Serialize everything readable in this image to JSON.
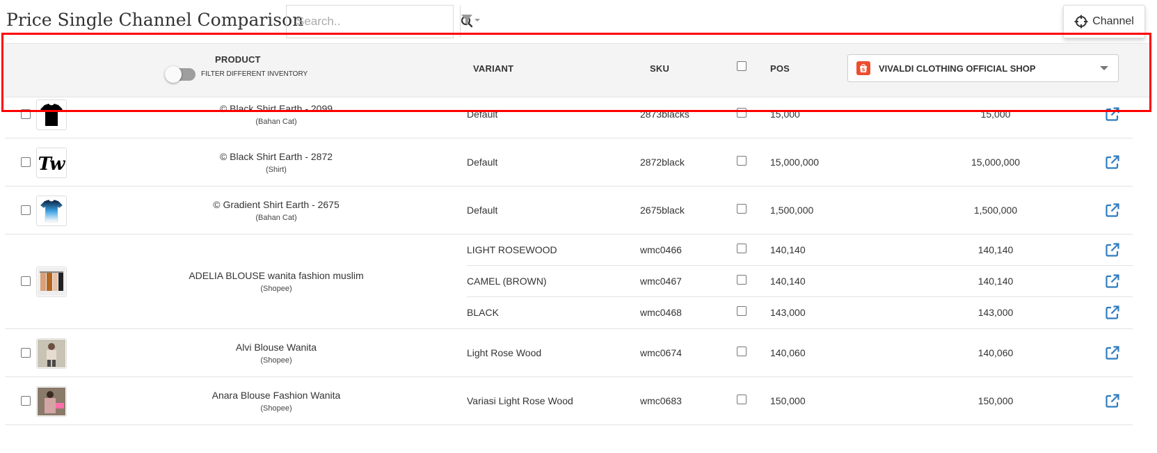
{
  "header": {
    "title": "Price Single Channel Comparison",
    "search_placeholder": "Search..",
    "channel_button": "Channel"
  },
  "table": {
    "columns": {
      "product": "PRODUCT",
      "filter_label": "FILTER DIFFERENT INVENTORY",
      "variant": "VARIANT",
      "sku": "SKU",
      "pos": "POS"
    },
    "selected_channel": "VIVALDI CLOTHING OFFICIAL SHOP",
    "products": [
      {
        "name": "© Black Shirt Earth - 2099",
        "category": "(Bahan Cat)",
        "thumb": "black-shirt",
        "variants": [
          {
            "variant": "Default",
            "sku": "2873blacks",
            "pos": "15,000",
            "channel": "15,000"
          }
        ]
      },
      {
        "name": "© Black Shirt Earth - 2872",
        "category": "(Shirt)",
        "thumb": "tw-logo",
        "variants": [
          {
            "variant": "Default",
            "sku": "2872black",
            "pos": "15,000,000",
            "channel": "15,000,000"
          }
        ]
      },
      {
        "name": "© Gradient Shirt Earth - 2675",
        "category": "(Bahan Cat)",
        "thumb": "gradient-shirt",
        "variants": [
          {
            "variant": "Default",
            "sku": "2675black",
            "pos": "1,500,000",
            "channel": "1,500,000"
          }
        ]
      },
      {
        "name": "ADELIA BLOUSE wanita fashion muslim",
        "category": "(Shopee)",
        "thumb": "blouse-rack",
        "variants": [
          {
            "variant": "LIGHT ROSEWOOD",
            "sku": "wmc0466",
            "pos": "140,140",
            "channel": "140,140"
          },
          {
            "variant": "CAMEL (BROWN)",
            "sku": "wmc0467",
            "pos": "140,140",
            "channel": "140,140"
          },
          {
            "variant": "BLACK",
            "sku": "wmc0468",
            "pos": "143,000",
            "channel": "143,000"
          }
        ]
      },
      {
        "name": "Alvi Blouse Wanita",
        "category": "(Shopee)",
        "thumb": "model-photo",
        "variants": [
          {
            "variant": "Light Rose Wood",
            "sku": "wmc0674",
            "pos": "140,060",
            "channel": "140,060"
          }
        ]
      },
      {
        "name": "Anara Blouse Fashion Wanita",
        "category": "(Shopee)",
        "thumb": "model-photo-2",
        "variants": [
          {
            "variant": "Variasi Light Rose Wood",
            "sku": "wmc0683",
            "pos": "150,000",
            "channel": "150,000"
          }
        ]
      }
    ]
  },
  "colors": {
    "accent": "#2f7bbf",
    "highlight": "#ff0000",
    "shopee": "#ee4d2d"
  }
}
